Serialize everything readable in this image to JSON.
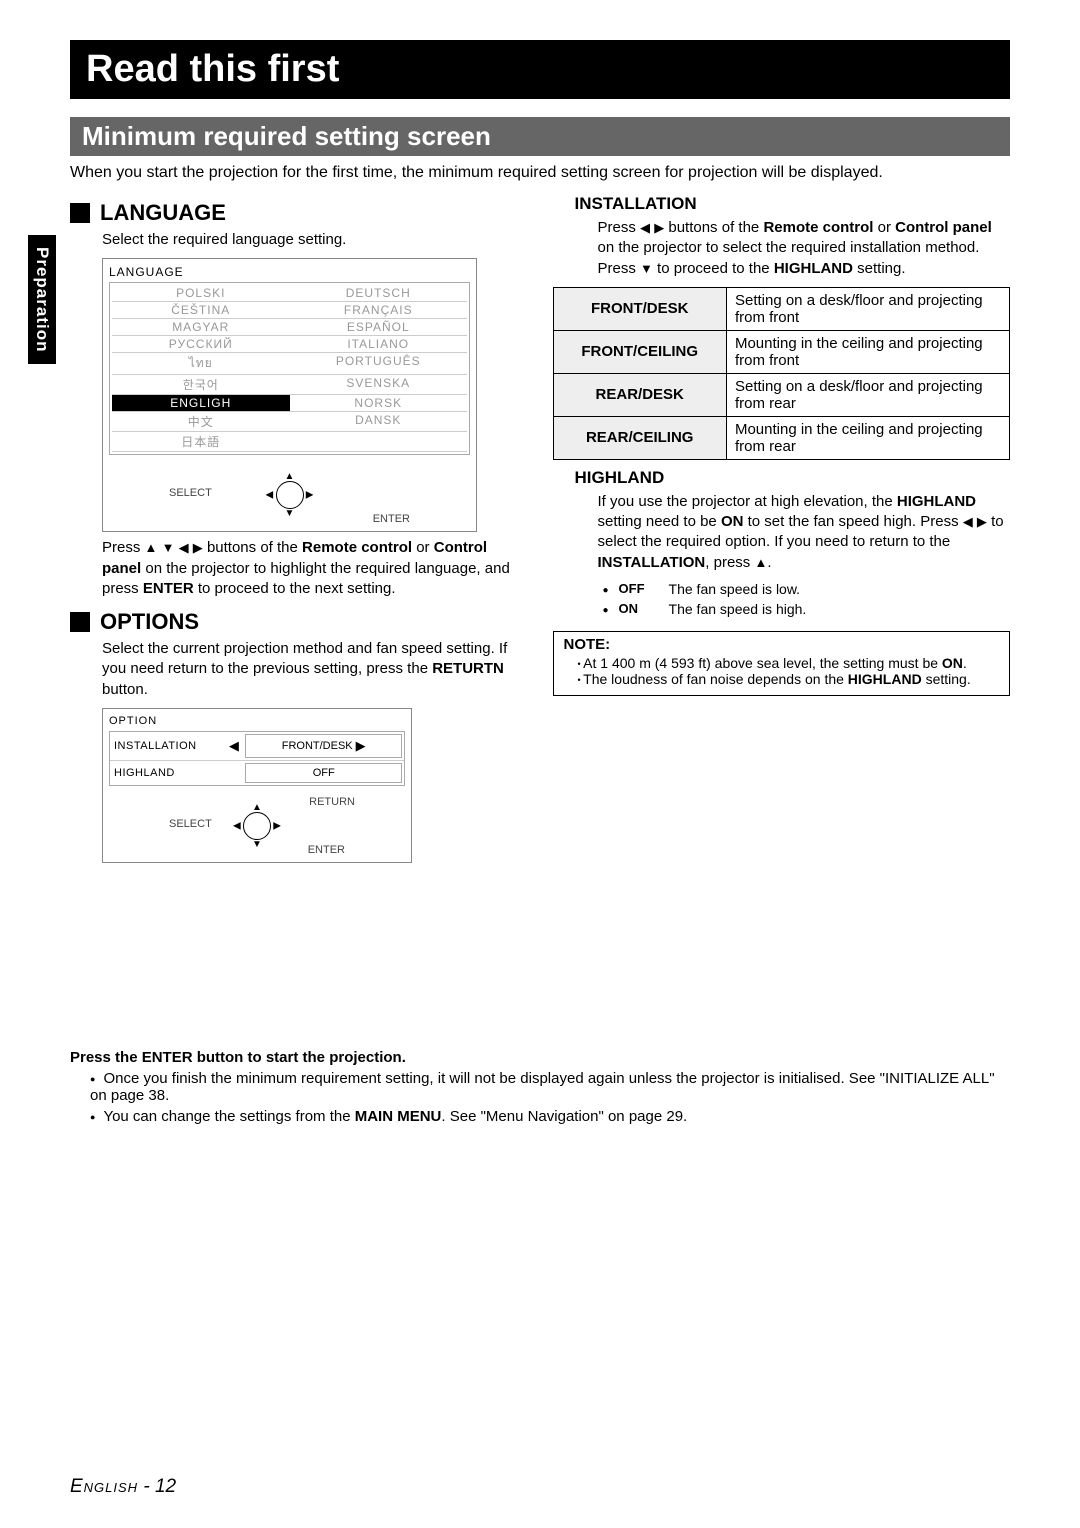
{
  "sideTab": "Preparation",
  "title": "Read this first",
  "subtitle": "Minimum required setting screen",
  "intro": "When you start the projection for the first time, the minimum required setting screen for projection will be displayed.",
  "language": {
    "heading": "LANGUAGE",
    "caption": "Select the required language setting.",
    "menuTitle": "LANGUAGE",
    "items": [
      "POLSKI",
      "DEUTSCH",
      "ČEŠTINA",
      "FRANÇAIS",
      "MAGYAR",
      "ESPAÑOL",
      "РУССКИЙ",
      "ITALIANO",
      "ไทย",
      "PORTUGUÊS",
      "한국어",
      "SVENSKA",
      "ENGLIGH",
      "NORSK",
      "中文",
      "DANSK",
      "日本語",
      ""
    ],
    "selectedIndex": 12,
    "navSelect": "SELECT",
    "navEnter": "ENTER",
    "instr_a": "Press ",
    "instr_b": " buttons of the ",
    "instr_remote": "Remote control",
    "instr_c": " or ",
    "instr_cp": "Control panel",
    "instr_d": " on the projector to highlight the required language, and press ",
    "instr_enter": "ENTER",
    "instr_e": " to proceed to the next setting."
  },
  "options": {
    "heading": "OPTIONS",
    "caption_a": "Select the current projection method and fan speed setting. If you need return to the previous setting, press the ",
    "caption_returtn": "RETURTN",
    "caption_b": " button.",
    "menuTitle": "OPTION",
    "row1k": "INSTALLATION",
    "row1v": "FRONT/DESK",
    "row2k": "HIGHLAND",
    "row2v": "OFF",
    "navSelect": "SELECT",
    "navEnter": "ENTER",
    "navReturn": "RETURN"
  },
  "installation": {
    "heading": "INSTALLATION",
    "instr_a": "Press ",
    "instr_b": " buttons of the ",
    "instr_remote": "Remote control",
    "instr_c": " or ",
    "instr_cp": "Control panel",
    "instr_d": " on the projector to select the required installation method. Press ",
    "instr_e": " to proceed to the ",
    "instr_highland": "HIGHLAND",
    "instr_f": " setting.",
    "table": [
      {
        "k": "FRONT/DESK",
        "v": "Setting on a desk/floor and projecting from front"
      },
      {
        "k": "FRONT/CEILING",
        "v": "Mounting in the ceiling and projecting from front"
      },
      {
        "k": "REAR/DESK",
        "v": "Setting on a desk/floor and projecting from rear"
      },
      {
        "k": "REAR/CEILING",
        "v": "Mounting in the ceiling and projecting from rear"
      }
    ]
  },
  "highland": {
    "heading": "HIGHLAND",
    "body_a": "If you use the projector at high elevation, the ",
    "body_hl": "HIGHLAND",
    "body_b": " setting need to be ",
    "body_on": "ON",
    "body_c": " to set the fan speed high. Press ",
    "body_d": " to select the required option. If you need to return to the ",
    "body_inst": "INSTALLATION",
    "body_e": ", press ",
    "body_f": ".",
    "opts": [
      {
        "k": "OFF",
        "v": "The fan speed is low."
      },
      {
        "k": "ON",
        "v": "The fan speed is high."
      }
    ]
  },
  "note": {
    "title": "NOTE:",
    "items": [
      {
        "a": "At 1 400 m (4 593 ft) above sea level, the setting must be ",
        "b": "ON",
        "c": "."
      },
      {
        "a": "The loudness of fan noise depends on the ",
        "b": "HIGHLAND",
        "c": " setting."
      }
    ]
  },
  "footer": {
    "heading": "Press the ENTER button to start the projection.",
    "items": [
      {
        "a": "Once you finish the minimum requirement setting, it will not be displayed again unless the projector is initialised. See \"INITIALIZE ALL\" on page 38.",
        "b": "",
        "c": ""
      },
      {
        "a": "You can change the settings from the ",
        "b": "MAIN MENU",
        "c": ". See \"Menu Navigation\" on page 29."
      }
    ]
  },
  "pageFoot": {
    "lang": "English",
    "sep": " - ",
    "num": "12"
  }
}
